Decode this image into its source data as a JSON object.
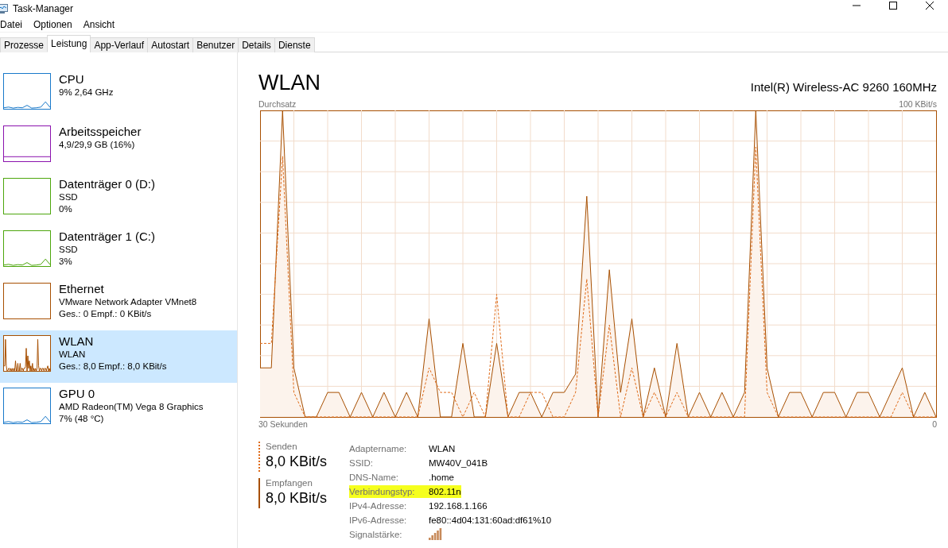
{
  "window": {
    "title": "Task-Manager"
  },
  "menu": [
    "Datei",
    "Optionen",
    "Ansicht"
  ],
  "tabs": [
    {
      "label": "Prozesse",
      "selected": false
    },
    {
      "label": "Leistung",
      "selected": true
    },
    {
      "label": "App-Verlauf",
      "selected": false
    },
    {
      "label": "Autostart",
      "selected": false
    },
    {
      "label": "Benutzer",
      "selected": false
    },
    {
      "label": "Details",
      "selected": false
    },
    {
      "label": "Dienste",
      "selected": false
    }
  ],
  "sidebar": {
    "items": [
      {
        "name": "CPU",
        "lines": [
          "9% 2,64 GHz"
        ],
        "color": "#1979ca",
        "selected": false
      },
      {
        "name": "Arbeitsspeicher",
        "lines": [
          "4,9/29,9 GB (16%)"
        ],
        "color": "#8b12ae",
        "selected": false
      },
      {
        "name": "Datenträger 0 (D:)",
        "lines": [
          "SSD",
          "0%"
        ],
        "color": "#4da60c",
        "selected": false
      },
      {
        "name": "Datenträger 1 (C:)",
        "lines": [
          "SSD",
          "3%"
        ],
        "color": "#4da60c",
        "selected": false
      },
      {
        "name": "Ethernet",
        "lines": [
          "VMware Network Adapter VMnet8",
          "Ges.: 0 Empf.: 0 KBit/s"
        ],
        "color": "#a74f01",
        "selected": false
      },
      {
        "name": "WLAN",
        "lines": [
          "WLAN",
          "Ges.: 8,0 Empf.: 8,0 KBit/s"
        ],
        "color": "#a74f01",
        "selected": true
      },
      {
        "name": "GPU 0",
        "lines": [
          "AMD Radeon(TM) Vega 8 Graphics",
          "7% (48 °C)"
        ],
        "color": "#1979ca",
        "selected": false
      }
    ]
  },
  "detail": {
    "title": "WLAN",
    "adapter": "Intel(R) Wireless-AC 9260 160MHz",
    "chart": {
      "label": "Durchsatz",
      "max": "100 KBit/s",
      "span": "30 Sekunden",
      "end": "0"
    },
    "stats": [
      {
        "kind": "send",
        "label": "Senden",
        "value": "8,0 KBit/s"
      },
      {
        "kind": "receive",
        "label": "Empfangen",
        "value": "8,0 KBit/s"
      }
    ],
    "properties": [
      {
        "kind": "text",
        "label": "Adaptername:",
        "value": "WLAN",
        "highlighted": false
      },
      {
        "kind": "text",
        "label": "SSID:",
        "value": "MW40V_041B",
        "highlighted": false
      },
      {
        "kind": "text",
        "label": "DNS-Name:",
        "value": ".home",
        "highlighted": false
      },
      {
        "kind": "text",
        "label": "Verbindungstyp:",
        "value": "802.11n",
        "highlighted": true
      },
      {
        "kind": "text",
        "label": "IPv4-Adresse:",
        "value": "192.168.1.166",
        "highlighted": false
      },
      {
        "kind": "text",
        "label": "IPv6-Adresse:",
        "value": "fe80::4d04:131:60ad:df61%10",
        "highlighted": false
      },
      {
        "kind": "signal",
        "label": "Signalstärke:",
        "highlighted": false
      }
    ]
  }
}
